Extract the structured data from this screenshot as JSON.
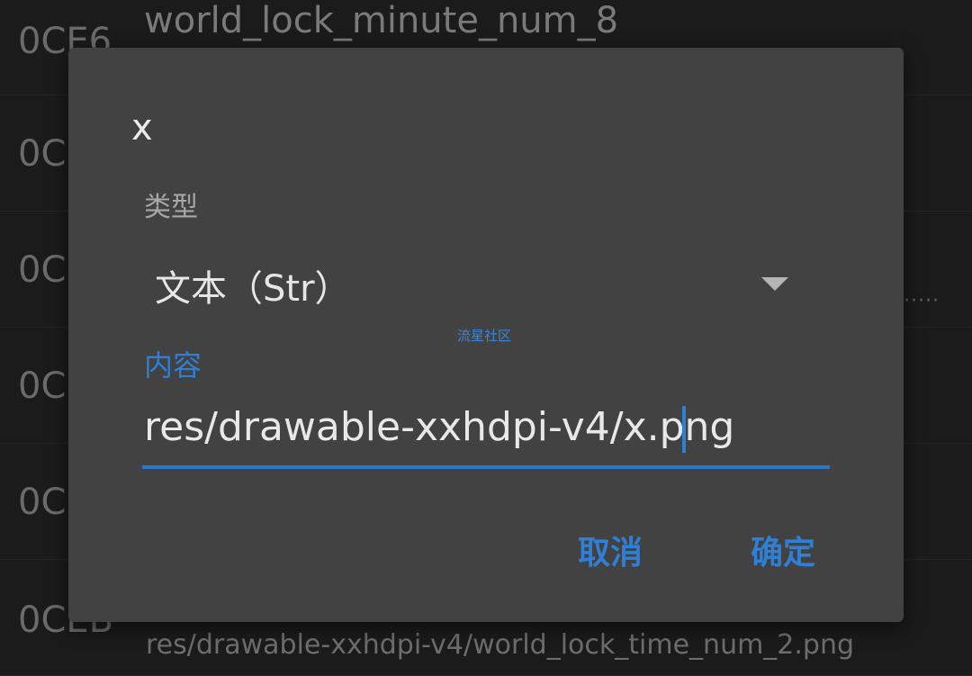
{
  "background": {
    "rows": [
      {
        "id": "0CE6",
        "name": "world_lock_minute_num_8",
        "value": ""
      },
      {
        "id": "0C",
        "name": "",
        "value": ""
      },
      {
        "id": "0C",
        "name": "",
        "value": ""
      },
      {
        "id": "0C",
        "name": "",
        "value": ""
      },
      {
        "id": "0C",
        "name": "",
        "value": ""
      },
      {
        "id": "0CEB",
        "name": "",
        "value": "res/drawable-xxhdpi-v4/world_lock_time_num_2.png"
      }
    ],
    "ellipsis": "·····"
  },
  "dialog": {
    "title": "x",
    "type_label": "类型",
    "type_value": "文本（Str）",
    "watermark": "流星社区",
    "content_label": "内容",
    "content_value": "res/drawable-xxhdpi-v4/x.png",
    "cancel_label": "取消",
    "ok_label": "确定"
  },
  "colors": {
    "accent": "#2f7fd6",
    "dialog_bg": "#424242",
    "screen_bg": "#1b1b1b"
  }
}
